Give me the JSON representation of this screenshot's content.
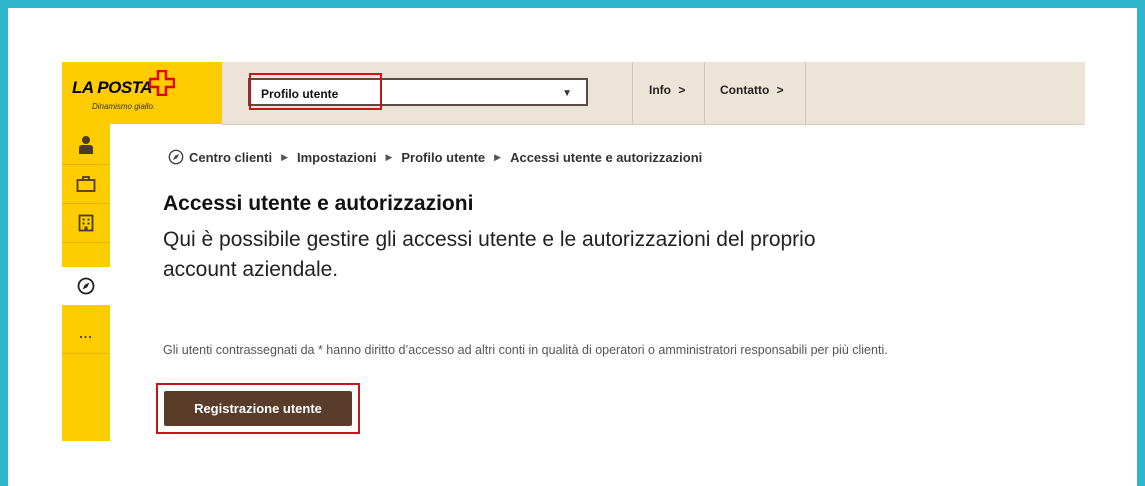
{
  "brand": {
    "name": "LA POSTA",
    "tagline": "Dinamismo giallo."
  },
  "topbar": {
    "select_value": "Profilo utente",
    "nav": [
      "Info",
      "Contatto"
    ]
  },
  "sidebar": {
    "items": [
      "person-icon",
      "briefcase-icon",
      "building-icon",
      "compass-icon",
      "more-icon"
    ],
    "more_label": "..."
  },
  "breadcrumb": [
    "Centro clienti",
    "Impostazioni",
    "Profilo utente",
    "Accessi utente e autorizzazioni"
  ],
  "main": {
    "title": "Accessi utente e autorizzazioni",
    "description": "Qui è possibile gestire gli accessi utente e le autorizzazioni del proprio account aziendale.",
    "note": "Gli utenti contrassegnati da * hanno diritto d’accesso ad altri conti in qualità di operatori o amministratori responsabili per più clienti.",
    "button": "Registrazione utente"
  },
  "colors": {
    "frame": "#2db6c9",
    "brand_yellow": "#ffcc00",
    "brand_red": "#e2001a",
    "button_brown": "#5a3c2a",
    "highlight_red": "#c4161c",
    "topbar_beige": "#ede4d8"
  }
}
